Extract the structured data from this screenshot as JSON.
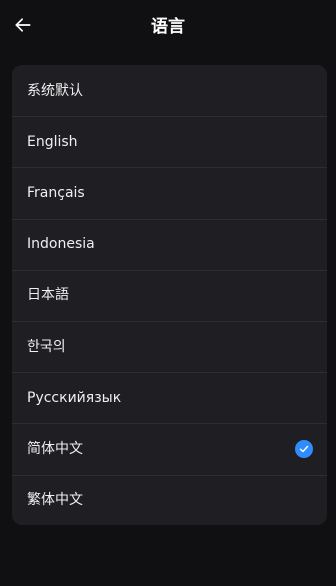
{
  "header": {
    "title": "语言",
    "back_icon": "arrow-left-icon"
  },
  "languages": [
    {
      "label": "系统默认",
      "selected": false
    },
    {
      "label": "English",
      "selected": false
    },
    {
      "label": "Français",
      "selected": false
    },
    {
      "label": "Indonesia",
      "selected": false
    },
    {
      "label": "日本語",
      "selected": false
    },
    {
      "label": "한국의",
      "selected": false
    },
    {
      "label": "Русскийязык",
      "selected": false
    },
    {
      "label": "简体中文",
      "selected": true
    },
    {
      "label": "繁体中文",
      "selected": false
    }
  ],
  "colors": {
    "background": "#101012",
    "card": "#1f1f23",
    "divider": "#2c2c31",
    "accent": "#2f8cff",
    "text": "#efefef"
  },
  "selected_icon": "checkmark-circle-icon"
}
